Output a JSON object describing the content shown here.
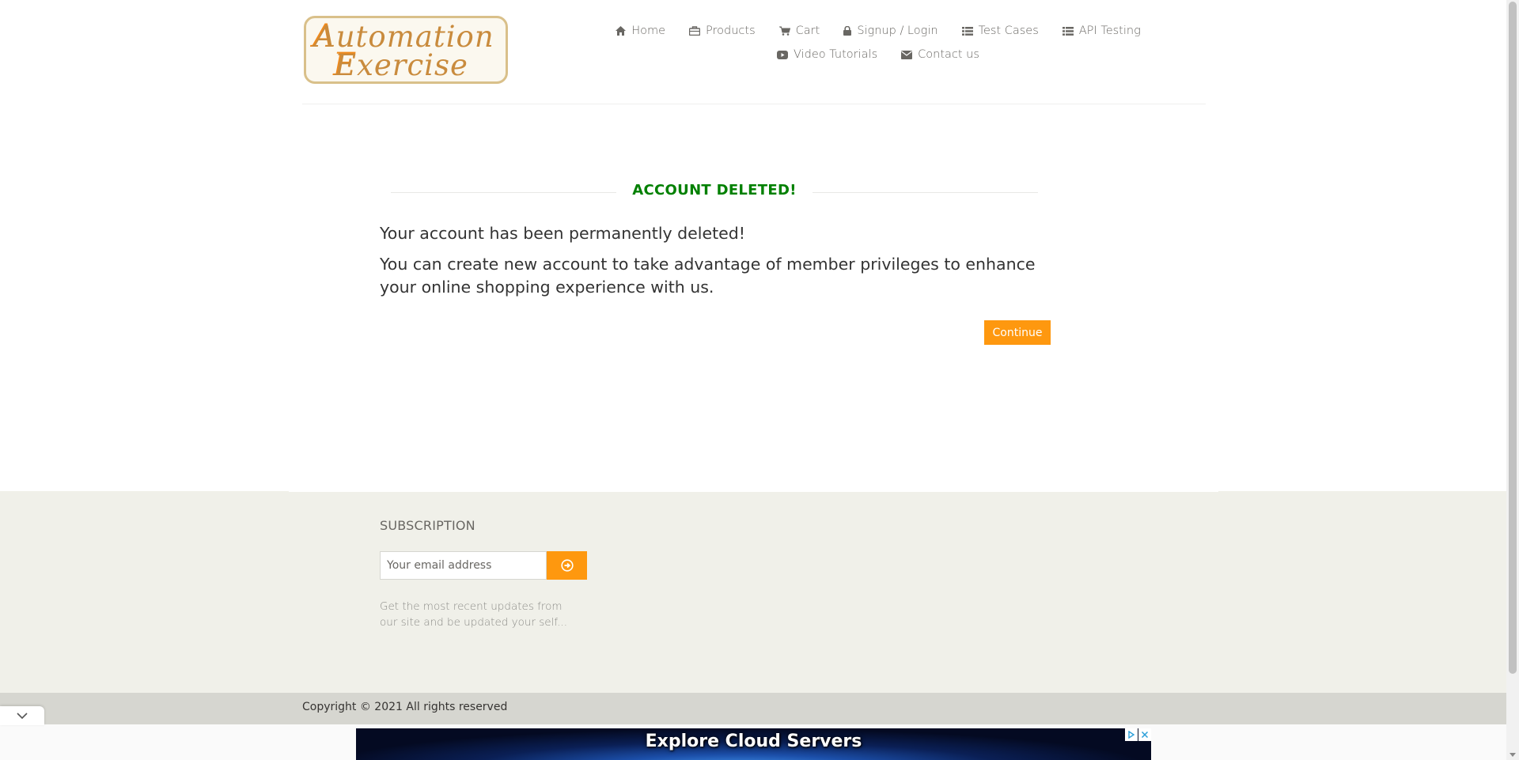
{
  "logo": {
    "line1": "Automation",
    "line2": "Exercise"
  },
  "nav": {
    "row1": [
      {
        "label": "Home",
        "icon": "home-icon"
      },
      {
        "label": "Products",
        "icon": "shopping-bag-icon"
      },
      {
        "label": "Cart",
        "icon": "cart-icon"
      },
      {
        "label": "Signup / Login",
        "icon": "lock-icon"
      },
      {
        "label": "Test Cases",
        "icon": "list-icon"
      },
      {
        "label": "API Testing",
        "icon": "list-icon"
      }
    ],
    "row2": [
      {
        "label": "Video Tutorials",
        "icon": "youtube-play-icon"
      },
      {
        "label": "Contact us",
        "icon": "envelope-icon"
      }
    ]
  },
  "main": {
    "title": "ACCOUNT DELETED!",
    "message1": "Your account has been permanently deleted!",
    "message2": "You can create new account to take advantage of member privileges to enhance your online shopping experience with us.",
    "continue_label": "Continue"
  },
  "footer": {
    "subscription_title": "SUBSCRIPTION",
    "email_placeholder": "Your email address",
    "subscription_desc": "Get the most recent updates from our site and be updated your self...",
    "copyright": "Copyright © 2021 All rights reserved"
  },
  "ad": {
    "text": "Explore Cloud Servers"
  },
  "colors": {
    "accent": "#fe980f",
    "success": "#008000",
    "footer_bg": "#f0f0e9"
  }
}
